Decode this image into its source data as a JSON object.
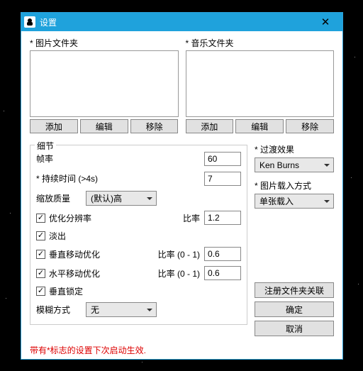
{
  "window": {
    "title": "设置"
  },
  "folders": {
    "image": {
      "label": "* 图片文件夹",
      "add": "添加",
      "edit": "编辑",
      "remove": "移除"
    },
    "music": {
      "label": "* 音乐文件夹",
      "add": "添加",
      "edit": "编辑",
      "remove": "移除"
    }
  },
  "details": {
    "legend": "细节",
    "framerate_label": "帧率",
    "framerate_value": "60",
    "duration_label": "* 持续时间 (>4s)",
    "duration_value": "7",
    "zoom_quality_label": "缩放质量",
    "zoom_quality_value": "(默认)高",
    "opt_resolution": "优化分辨率",
    "ratio_label": "比率",
    "ratio_value": "1.2",
    "fade_out": "淡出",
    "vertical_move_opt": "垂直移动优化",
    "vratio_label": "比率 (0 - 1)",
    "vratio_value": "0.6",
    "horizontal_move_opt": "水平移动优化",
    "hratio_label": "比率 (0 - 1)",
    "hratio_value": "0.6",
    "vertical_lock": "垂直锁定",
    "blur_mode_label": "模糊方式",
    "blur_mode_value": "无"
  },
  "right": {
    "transition_label": "* 过渡效果",
    "transition_value": "Ken Burns",
    "load_mode_label": "* 图片载入方式",
    "load_mode_value": "单张载入",
    "register_assoc": "注册文件夹关联",
    "ok": "确定",
    "cancel": "取消"
  },
  "footer": "带有*标志的设置下次启动生效."
}
